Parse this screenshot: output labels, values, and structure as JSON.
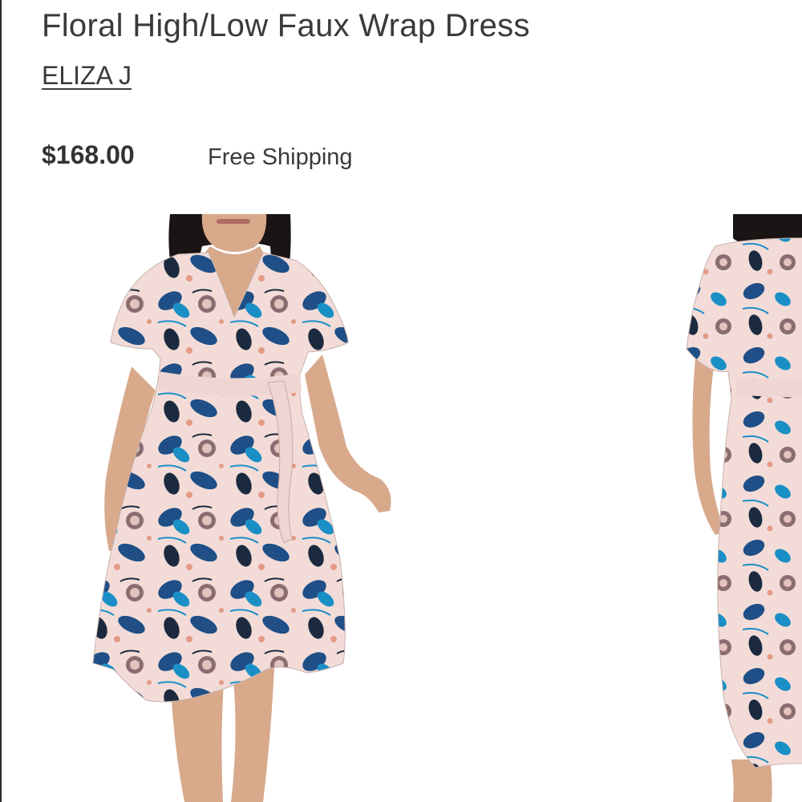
{
  "product": {
    "title": "Floral High/Low Faux Wrap Dress",
    "brand": "ELIZA J",
    "price": "$168.00",
    "shipping": "Free Shipping"
  },
  "gallery": {
    "images": [
      {
        "name": "front-view"
      },
      {
        "name": "side-view"
      }
    ]
  },
  "colors": {
    "text": "#3a3a3a",
    "dress_base": "#f3dcd8",
    "print_navy": "#1f4f86",
    "print_teal": "#1a8fc6",
    "print_dark": "#1b2a3e",
    "print_coral": "#e59a85",
    "skin": "#d8a98b",
    "hair": "#1a1414"
  }
}
